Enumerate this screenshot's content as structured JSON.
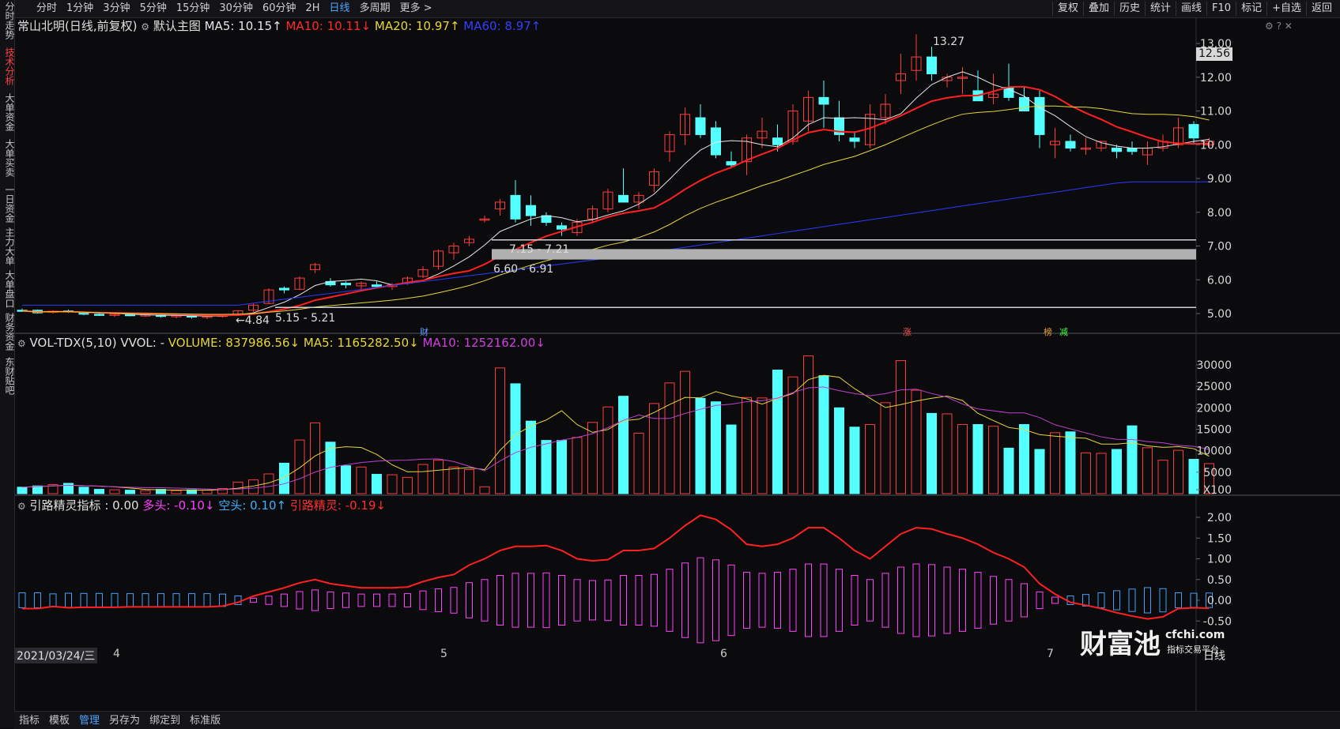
{
  "toolbar": {
    "tabs": [
      "分时",
      "1分钟",
      "3分钟",
      "5分钟",
      "15分钟",
      "30分钟",
      "60分钟",
      "2H",
      "日线",
      "多周期",
      "更多 >"
    ],
    "active_tab": "日线",
    "right_buttons": [
      "复权",
      "叠加",
      "历史",
      "统计",
      "画线",
      "F10",
      "标记",
      "+自选",
      "返回"
    ]
  },
  "sidebar": {
    "items": [
      "分时走势",
      "技术分析",
      "大单资金",
      "大单买卖",
      "一日资金",
      "主力大单",
      "大单盘口",
      "财务资金",
      "东财贴吧"
    ],
    "active": "技术分析"
  },
  "main_panel": {
    "stock_name": "常山北明(日线,前复权)",
    "template": "默认主图",
    "ma5": "MA5: 10.15↑",
    "ma10": "MA10: 10.11↓",
    "ma20": "MA20: 10.97↑",
    "ma60": "MA60: 8.97↑",
    "y_ticks": [
      "13.00",
      "12.00",
      "11.00",
      "10.00",
      "9.00",
      "8.00",
      "7.00",
      "6.00",
      "5.00"
    ],
    "current_price": "12.56",
    "high_label": "13.27",
    "low_label": "←4.84",
    "zone1_label": "7.15 - 7.21",
    "zone2_label": "6.60 - 6.91",
    "zone3_label": "5.15 - 5.21",
    "markers": [
      "财",
      "涨",
      "榜",
      "减"
    ]
  },
  "volume_panel": {
    "title": "VOL-TDX(5,10) VVOL: -",
    "volume": "VOLUME: 837986.56↓",
    "ma5": "MA5: 1165282.50↓",
    "ma10": "MA10: 1252162.00↓",
    "y_ticks": [
      "30000",
      "25000",
      "20000",
      "15000",
      "10000",
      "5000",
      "X100"
    ]
  },
  "indicator_panel": {
    "title": "引路精灵指标 : 0.00",
    "duotou": "多头: -0.10↓",
    "kongtou": "空头: 0.10↑",
    "jingling": "引路精灵: -0.19↓",
    "y_ticks": [
      "2.00",
      "1.50",
      "1.00",
      "0.50",
      "0.00",
      "-0.50"
    ]
  },
  "x_axis": {
    "date": "2021/03/24/三",
    "months": [
      "4",
      "5",
      "6",
      "7"
    ],
    "period": "日线"
  },
  "watermark": {
    "brand": "财富池",
    "url": "cfchi.com",
    "slogan": "指标交易平台"
  },
  "bottom_bar": [
    "指标",
    "模板",
    "管理",
    "另存为",
    "绑定到",
    "标准版"
  ],
  "bottom_active": "管理",
  "colors": {
    "up": "#ff3c3c",
    "down": "#54ffff",
    "ma5": "#e6e6e6",
    "ma10": "#ff2020",
    "ma20": "#e6d63a",
    "ma60": "#2a3aff",
    "vol_ma5": "#e6d63a",
    "vol_ma10": "#c040d0",
    "duotou": "#ff40ff",
    "kongtou": "#40a0ff"
  },
  "chart_data": {
    "type": "candlestick",
    "ohlc": [
      [
        5.1,
        5.15,
        5.05,
        5.08
      ],
      [
        5.1,
        5.12,
        5.0,
        5.02
      ],
      [
        5.05,
        5.1,
        5.0,
        5.07
      ],
      [
        5.08,
        5.12,
        5.02,
        5.05
      ],
      [
        5.03,
        5.05,
        4.95,
        4.98
      ],
      [
        4.98,
        5.02,
        4.93,
        4.95
      ],
      [
        4.96,
        5.0,
        4.9,
        4.98
      ],
      [
        4.97,
        5.0,
        4.92,
        4.94
      ],
      [
        4.95,
        4.98,
        4.9,
        4.96
      ],
      [
        4.95,
        4.97,
        4.88,
        4.92
      ],
      [
        4.92,
        4.96,
        4.86,
        4.94
      ],
      [
        4.93,
        4.96,
        4.85,
        4.9
      ],
      [
        4.9,
        4.93,
        4.84,
        4.92
      ],
      [
        4.92,
        4.96,
        4.88,
        4.95
      ],
      [
        4.96,
        5.1,
        4.95,
        5.08
      ],
      [
        5.1,
        5.3,
        5.05,
        5.25
      ],
      [
        5.3,
        5.75,
        5.28,
        5.7
      ],
      [
        5.75,
        5.8,
        5.6,
        5.7
      ],
      [
        5.72,
        6.1,
        5.7,
        6.05
      ],
      [
        6.3,
        6.5,
        6.2,
        6.45
      ],
      [
        5.95,
        6.05,
        5.8,
        5.85
      ],
      [
        5.9,
        5.95,
        5.75,
        5.85
      ],
      [
        5.82,
        5.95,
        5.7,
        5.9
      ],
      [
        5.85,
        5.95,
        5.75,
        5.8
      ],
      [
        5.8,
        5.9,
        5.7,
        5.85
      ],
      [
        5.9,
        6.1,
        5.85,
        6.05
      ],
      [
        6.1,
        6.4,
        6.05,
        6.3
      ],
      [
        6.4,
        6.9,
        6.3,
        6.85
      ],
      [
        6.8,
        7.1,
        6.6,
        7.0
      ],
      [
        7.1,
        7.3,
        7.0,
        7.2
      ],
      [
        7.8,
        7.9,
        7.7,
        7.8
      ],
      [
        8.1,
        8.4,
        7.9,
        8.3
      ],
      [
        8.5,
        8.95,
        7.7,
        7.8
      ],
      [
        8.2,
        8.5,
        7.6,
        7.9
      ],
      [
        7.9,
        8.0,
        7.6,
        7.7
      ],
      [
        7.6,
        7.7,
        7.3,
        7.5
      ],
      [
        7.4,
        7.8,
        7.3,
        7.7
      ],
      [
        7.8,
        8.2,
        7.7,
        8.1
      ],
      [
        8.1,
        8.7,
        8.0,
        8.6
      ],
      [
        8.5,
        9.3,
        8.4,
        8.3
      ],
      [
        8.3,
        8.6,
        8.1,
        8.5
      ],
      [
        8.8,
        9.3,
        8.6,
        9.2
      ],
      [
        9.8,
        10.4,
        9.5,
        10.3
      ],
      [
        10.3,
        11.1,
        10.0,
        10.9
      ],
      [
        10.8,
        11.2,
        10.2,
        10.3
      ],
      [
        10.5,
        10.7,
        9.6,
        9.7
      ],
      [
        9.5,
        9.8,
        9.3,
        9.4
      ],
      [
        9.5,
        10.3,
        9.1,
        10.2
      ],
      [
        10.2,
        10.8,
        9.9,
        10.4
      ],
      [
        10.2,
        10.6,
        9.8,
        10.0
      ],
      [
        10.1,
        11.2,
        10.0,
        11.0
      ],
      [
        10.7,
        11.6,
        10.4,
        11.4
      ],
      [
        11.4,
        11.9,
        10.5,
        11.2
      ],
      [
        10.8,
        11.3,
        10.1,
        10.3
      ],
      [
        10.2,
        10.4,
        9.9,
        10.1
      ],
      [
        10.0,
        11.2,
        9.9,
        10.9
      ],
      [
        10.8,
        11.5,
        10.6,
        11.2
      ],
      [
        11.9,
        12.7,
        11.5,
        12.1
      ],
      [
        12.2,
        13.27,
        11.9,
        12.6
      ],
      [
        12.6,
        12.9,
        11.9,
        12.1
      ],
      [
        11.9,
        12.1,
        11.7,
        12.0
      ],
      [
        12.0,
        12.3,
        11.5,
        12.0
      ],
      [
        11.6,
        12.2,
        11.3,
        11.3
      ],
      [
        11.4,
        12.1,
        11.2,
        11.5
      ],
      [
        11.7,
        12.4,
        11.3,
        11.4
      ],
      [
        11.4,
        11.7,
        11.0,
        11.0
      ],
      [
        11.4,
        11.6,
        9.9,
        10.3
      ],
      [
        10.0,
        10.5,
        9.6,
        10.1
      ],
      [
        10.1,
        10.3,
        9.8,
        9.9
      ],
      [
        9.9,
        10.2,
        9.7,
        9.9
      ],
      [
        9.9,
        10.1,
        9.8,
        10.1
      ],
      [
        9.9,
        10.0,
        9.6,
        9.8
      ],
      [
        9.9,
        10.1,
        9.7,
        9.8
      ],
      [
        9.7,
        10.1,
        9.4,
        9.9
      ],
      [
        9.9,
        10.3,
        9.8,
        10.1
      ],
      [
        10.0,
        10.8,
        9.9,
        10.5
      ],
      [
        10.6,
        10.7,
        10.0,
        10.2
      ],
      [
        10.0,
        10.2,
        9.9,
        10.1
      ]
    ],
    "volume": [
      1500,
      1800,
      2100,
      2400,
      1500,
      1000,
      900,
      800,
      700,
      1000,
      700,
      900,
      800,
      1200,
      2700,
      3200,
      4600,
      7100,
      12500,
      16500,
      12000,
      6500,
      6200,
      4500,
      4400,
      3800,
      6800,
      7800,
      6200,
      5600,
      1600,
      29300,
      25600,
      16900,
      12400,
      12400,
      13100,
      16600,
      20200,
      22700,
      14100,
      21000,
      25800,
      28500,
      22200,
      21400,
      16000,
      22400,
      22300,
      28800,
      27200,
      32100,
      27500,
      20000,
      15500,
      16100,
      21200,
      31000,
      24100,
      18700,
      18600,
      16100,
      16100,
      15700,
      10600,
      16100,
      10300,
      14200,
      14400,
      9500,
      9400,
      10300,
      15800,
      10700,
      7800,
      10100,
      8000,
      7000
    ],
    "vol_ylim": [
      0,
      30000
    ],
    "price_ylim": [
      4.5,
      13.5
    ],
    "indicator_red": [
      -0.2,
      -0.2,
      -0.15,
      -0.18,
      -0.17,
      -0.17,
      -0.17,
      -0.16,
      -0.16,
      -0.16,
      -0.16,
      -0.16,
      -0.16,
      -0.14,
      -0.05,
      0.1,
      0.2,
      0.3,
      0.42,
      0.5,
      0.4,
      0.35,
      0.3,
      0.3,
      0.3,
      0.32,
      0.45,
      0.55,
      0.62,
      0.85,
      1.0,
      1.2,
      1.3,
      1.3,
      1.32,
      1.2,
      1.0,
      0.95,
      0.98,
      1.2,
      1.2,
      1.25,
      1.5,
      1.8,
      2.05,
      1.95,
      1.7,
      1.35,
      1.3,
      1.35,
      1.5,
      1.75,
      1.75,
      1.5,
      1.2,
      1.0,
      1.3,
      1.6,
      1.75,
      1.72,
      1.6,
      1.5,
      1.35,
      1.15,
      1.0,
      0.8,
      0.4,
      0.15,
      -0.05,
      -0.12,
      -0.2,
      -0.3,
      -0.38,
      -0.45,
      -0.4,
      -0.2,
      -0.18,
      -0.19
    ],
    "ylim_indicator": [
      -0.8,
      2.2
    ]
  }
}
